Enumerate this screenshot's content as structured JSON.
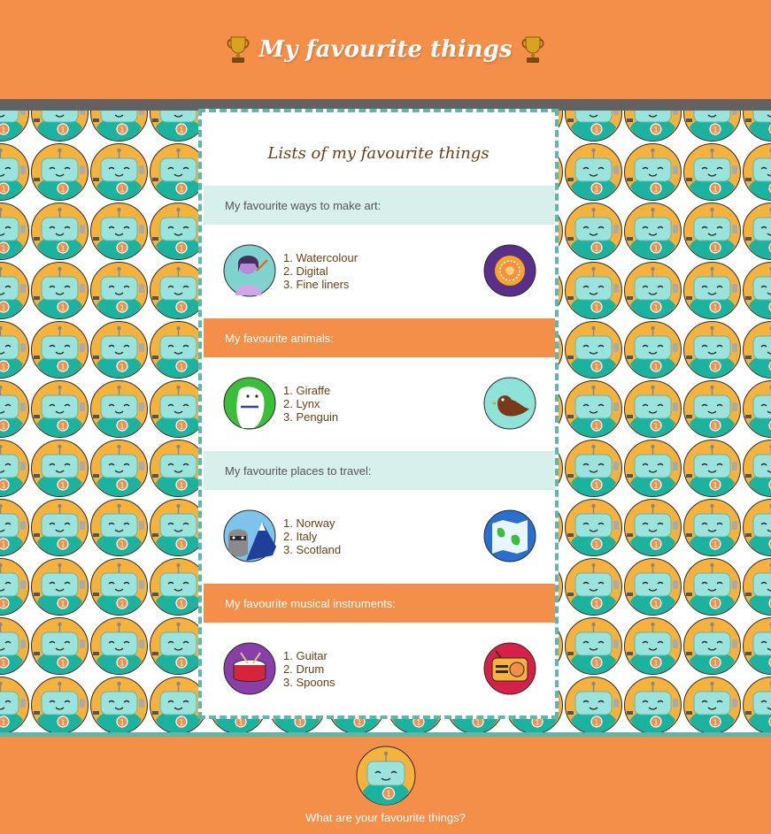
{
  "header": {
    "title": "My favourite things"
  },
  "card": {
    "title": "Lists of my favourite things",
    "sections": [
      {
        "heading": "My favourite ways to make art:",
        "items": [
          "1. Watercolour",
          "2. Digital",
          "3. Fine liners"
        ],
        "left_icon": "artist-avatar-icon",
        "right_icon": "mandala-icon"
      },
      {
        "heading": "My favourite animals:",
        "items": [
          "1. Giraffe",
          "2. Lynx",
          "3. Penguin"
        ],
        "left_icon": "polar-bear-icon",
        "right_icon": "bird-icon"
      },
      {
        "heading": "My favourite places to travel:",
        "items": [
          "1. Norway",
          "2. Italy",
          "3. Scotland"
        ],
        "left_icon": "raccoon-mountain-icon",
        "right_icon": "map-icon"
      },
      {
        "heading": "My favourite musical instruments:",
        "items": [
          "1. Guitar",
          "2. Drum",
          "3. Spoons"
        ],
        "left_icon": "drum-icon",
        "right_icon": "radio-icon"
      }
    ]
  },
  "footer": {
    "text": "What are your favourite things?"
  },
  "colors": {
    "orange": "#f48f49",
    "teal": "#5cb8ad",
    "light_teal": "#d7f0ec",
    "grey_bar": "#626262",
    "brown_text": "#6b3f12"
  }
}
